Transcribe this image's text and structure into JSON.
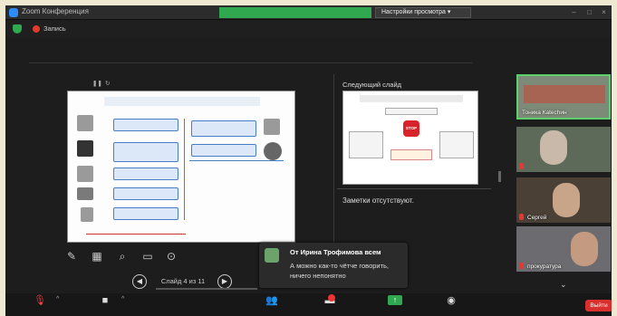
{
  "window": {
    "title": "Zoom Конференция",
    "view_banner": "",
    "view_options": "Настройки просмотра ▾",
    "view_toggle": ""
  },
  "meeting_bar": {
    "record_label": "Запись"
  },
  "presenter_toolbar": {
    "items": [
      "",
      "",
      ""
    ]
  },
  "current_slide": {
    "elapsed": "",
    "clock": "",
    "heading": "",
    "red_caption": ""
  },
  "slide_nav": {
    "prev_icon": "chevron-left",
    "next_icon": "chevron-right",
    "counter": "Слайд 4 из 11"
  },
  "next_slide": {
    "label": "Следующий слайд",
    "stop_text": "STOP"
  },
  "notes": {
    "text": "Заметки отсутствуют."
  },
  "participants": [
    {
      "name": "Тоника Каtechин",
      "muted": false,
      "active": true
    },
    {
      "name": "",
      "muted": true,
      "active": false
    },
    {
      "name": "Сергей",
      "muted": true,
      "active": false
    },
    {
      "name": "прокуратура",
      "muted": true,
      "active": false
    }
  ],
  "chat_toast": {
    "sender": "От Ирина Трофимова всем",
    "message": "А можно как-то чётче говорить, ничего непонятно"
  },
  "controls": {
    "audio_label": "",
    "video_label": "",
    "participants_label": "",
    "participants_count": "",
    "chat_label": "",
    "chat_badge": "",
    "share_label": "",
    "record_label": "",
    "end_label": "Выйти"
  },
  "colors": {
    "accent_green": "#2fa84f",
    "end_red": "#d9302e",
    "zoom_blue": "#2d8cff",
    "active_border": "#5bd06b"
  }
}
